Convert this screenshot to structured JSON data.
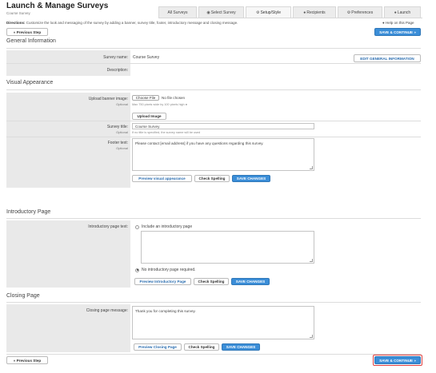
{
  "header": {
    "title": "Launch & Manage Surveys",
    "subtitle": "Course Survey",
    "directions_label": "Directions:",
    "directions_text": "Customize the look and messaging of the survey by adding a banner, survey title, footer, introductory message and closing message.",
    "help_text": "Help on this Page"
  },
  "tabs": [
    {
      "label": "All Surveys",
      "icon": ""
    },
    {
      "label": "Select Survey",
      "icon": "check-circle-icon"
    },
    {
      "label": "Setup/Style",
      "icon": "gear-icon"
    },
    {
      "label": "Recipients",
      "icon": "person-icon"
    },
    {
      "label": "Preferences",
      "icon": "gear-icon"
    },
    {
      "label": "Launch",
      "icon": "rocket-icon"
    }
  ],
  "buttons": {
    "previous_step": "« Previous Step",
    "save_continue": "SAVE & CONTINUE »",
    "edit_general": "EDIT GENERAL INFORMATION",
    "upload_image": "Upload Image",
    "preview_visual": "Preview visual appearance",
    "check_spelling": "Check Spelling",
    "save_changes": "SAVE CHANGES",
    "preview_intro": "Preview Introductory Page",
    "preview_closing": "Preview Closing Page"
  },
  "general": {
    "heading": "General Information",
    "survey_name_label": "Survey name:",
    "survey_name_value": "Course Survey",
    "description_label": "Description:",
    "description_value": ""
  },
  "visual": {
    "heading": "Visual Appearance",
    "banner_label": "Upload banner image:",
    "optional": "Optional",
    "choose_file": "Choose File",
    "no_file": "No file chosen",
    "banner_hint": "Max 750 pixels wide by 100 pixels high",
    "survey_title_label": "Survey title:",
    "survey_title_value": "Course Survey",
    "survey_title_hint": "If no title is specified, the survey name will be used",
    "footer_label": "Footer text:",
    "footer_value": "Please contact [email address] if you have any questions regarding this survey."
  },
  "intro": {
    "heading": "Introductory Page",
    "label": "Introductory page text:",
    "include_option": "Include an introductory page",
    "none_option": "No introductory page required."
  },
  "closing": {
    "heading": "Closing Page",
    "label": "Closing page message:",
    "value": "Thank you for completing this survey."
  }
}
